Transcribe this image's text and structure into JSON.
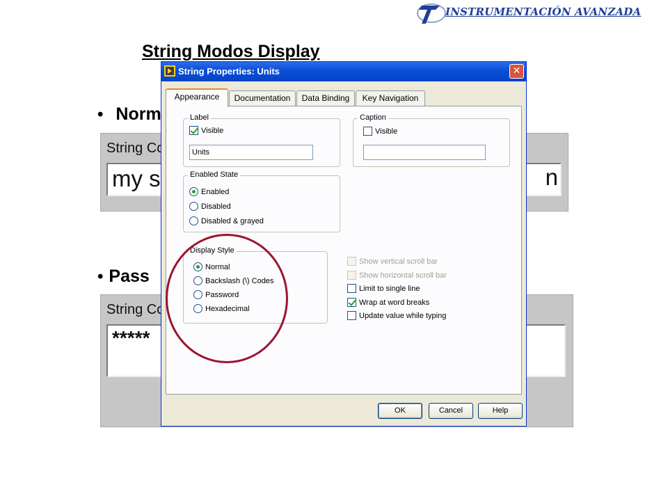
{
  "header": {
    "brand": "INSTRUMENTACIÓN AVANZADA"
  },
  "slide": {
    "title": "String Modos Display",
    "bullet_normal": "Norm",
    "bullet_password": "Pass",
    "bullet_glyph": "•"
  },
  "panel_normal": {
    "label": "String Con",
    "value": "my st",
    "tail": "n"
  },
  "panel_password": {
    "label": "String Co",
    "value": "*****"
  },
  "dialog": {
    "title": "String Properties: Units",
    "close_glyph": "✕",
    "tabs": [
      "Appearance",
      "Documentation",
      "Data Binding",
      "Key Navigation"
    ],
    "active_tab": "Appearance",
    "label_group": {
      "title": "Label",
      "visible_label": "Visible",
      "visible_checked": true,
      "text_value": "Units"
    },
    "caption_group": {
      "title": "Caption",
      "visible_label": "Visible",
      "visible_checked": false,
      "text_value": ""
    },
    "enabled_state": {
      "title": "Enabled State",
      "options": [
        "Enabled",
        "Disabled",
        "Disabled & grayed"
      ],
      "selected": "Enabled"
    },
    "display_style": {
      "title": "Display Style",
      "options": [
        "Normal",
        "Backslash (\\) Codes",
        "Password",
        "Hexadecimal"
      ],
      "selected": "Normal"
    },
    "checkboxes": [
      {
        "label": "Show vertical scroll bar",
        "checked": false,
        "enabled": false
      },
      {
        "label": "Show horizontal scroll bar",
        "checked": false,
        "enabled": false
      },
      {
        "label": "Limit to single line",
        "checked": false,
        "enabled": true
      },
      {
        "label": "Wrap at word breaks",
        "checked": true,
        "enabled": true
      },
      {
        "label": "Update value while typing",
        "checked": false,
        "enabled": true
      }
    ],
    "buttons": {
      "ok": "OK",
      "cancel": "Cancel",
      "help": "Help"
    }
  },
  "colors": {
    "title_text": "#1f3f9a",
    "dialog_titlebar": "#0a4fd8",
    "dialog_body": "#ece9d8",
    "highlight_ring": "#9b1530",
    "check_mark": "#21a121"
  }
}
